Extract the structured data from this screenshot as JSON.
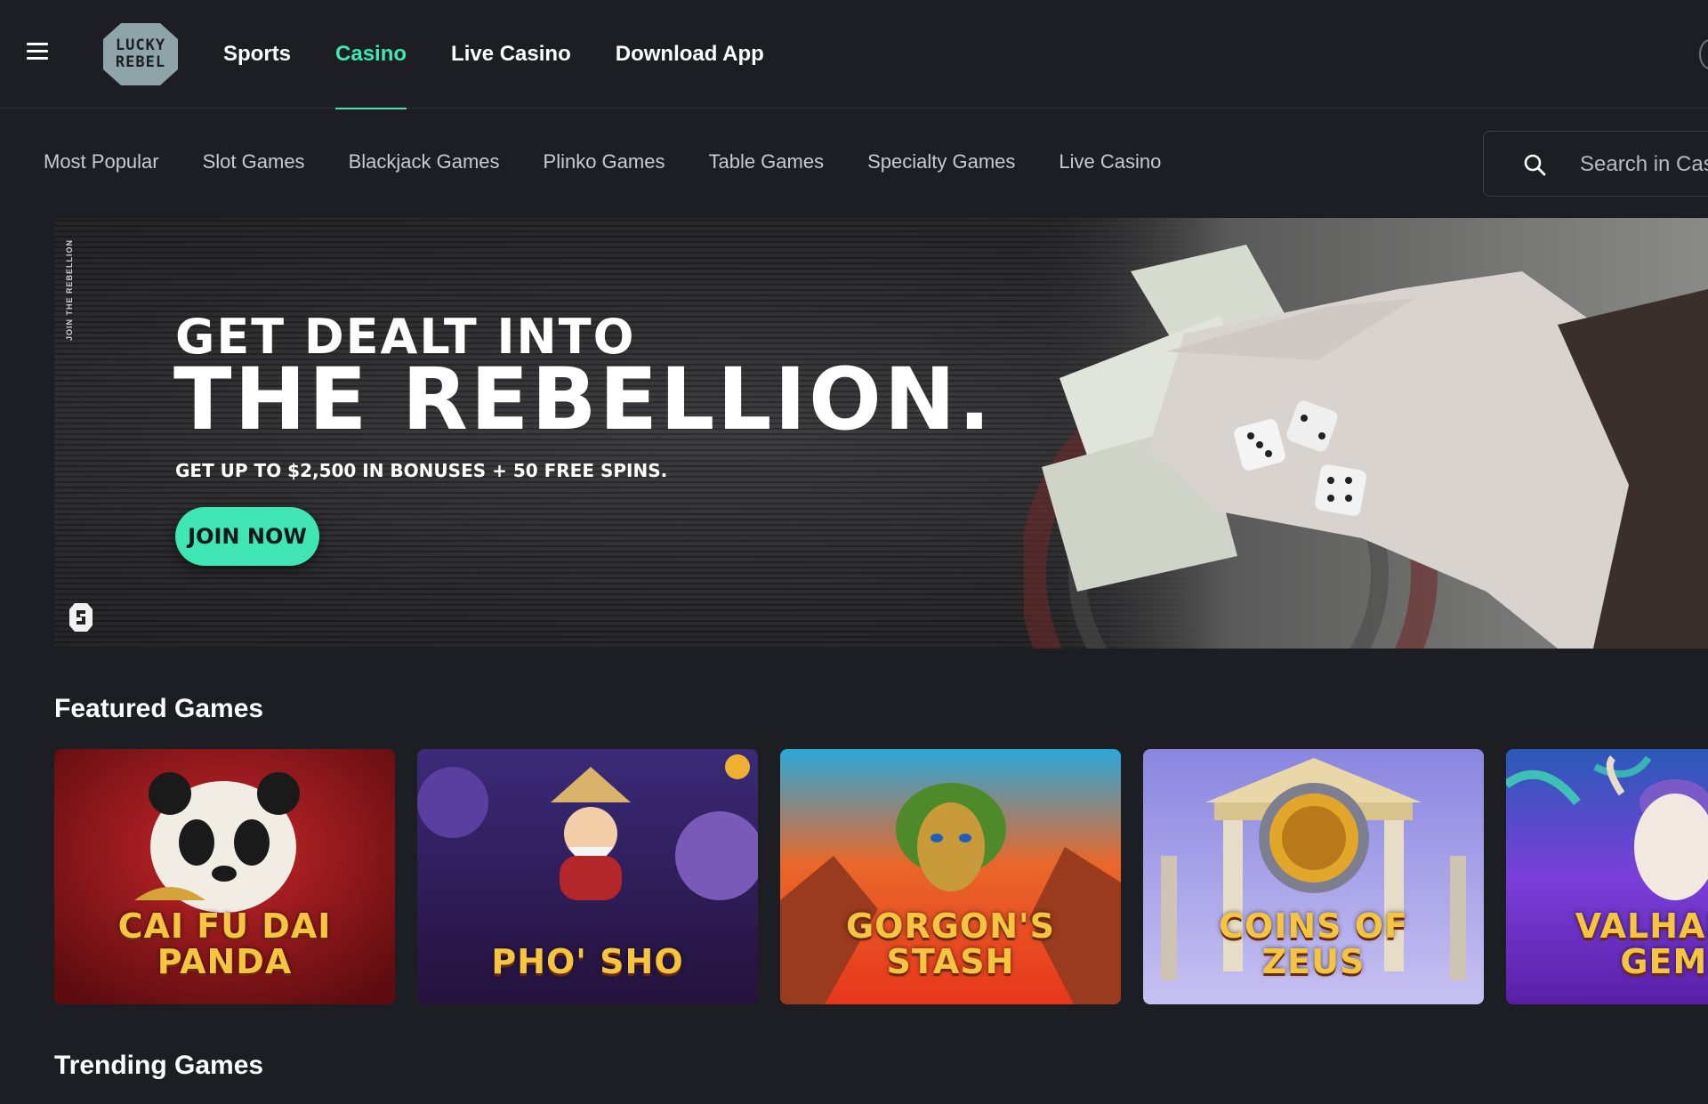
{
  "brand": {
    "logo_line1": "LUCKY",
    "logo_line2": "REBEL",
    "accent": "#3fe6b4"
  },
  "top_nav": [
    {
      "label": "Sports",
      "active": false
    },
    {
      "label": "Casino",
      "active": true
    },
    {
      "label": "Live Casino",
      "active": false
    },
    {
      "label": "Download App",
      "active": false
    }
  ],
  "sub_nav": [
    "Most Popular",
    "Slot Games",
    "Blackjack Games",
    "Plinko Games",
    "Table Games",
    "Specialty Games",
    "Live Casino"
  ],
  "search": {
    "placeholder": "Search in Casino",
    "icon": "search-icon"
  },
  "hero": {
    "side_text": "JOIN THE REBELLION",
    "line1": "GET DEALT INTO",
    "line2": "THE REBELLION.",
    "subtitle": "GET UP TO $2,500 IN BONUSES + 50 FREE SPINS.",
    "cta": "JOIN NOW"
  },
  "featured": {
    "title": "Featured Games",
    "games": [
      {
        "name": "CAI FU DAI\nPANDA"
      },
      {
        "name": "PHO' SHO"
      },
      {
        "name": "GORGON'S\nSTASH"
      },
      {
        "name": "COINS OF\nZEUS"
      },
      {
        "name": "VALHALLA\nGEMS"
      }
    ]
  },
  "trending": {
    "title": "Trending Games"
  }
}
